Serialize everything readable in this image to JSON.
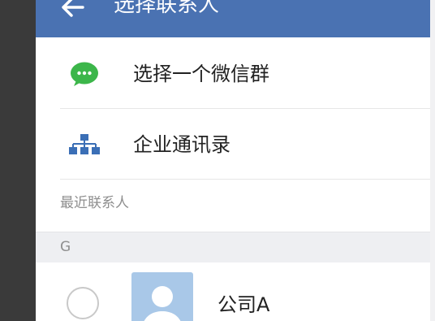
{
  "header": {
    "title": "选择联系人",
    "back_icon": "arrow-left-icon",
    "background": "#4a72b2"
  },
  "menu": [
    {
      "label": "选择一个微信群",
      "icon": "wechat-icon",
      "icon_color": "#3cb64a"
    },
    {
      "label": "企业通讯录",
      "icon": "org-chart-icon",
      "icon_color": "#3b6fb6"
    }
  ],
  "recent_section": {
    "label": "最近联系人"
  },
  "index_letter": "G",
  "contacts": [
    {
      "name": "公司A",
      "selected": false,
      "avatar_icon": "person-avatar-icon"
    }
  ]
}
